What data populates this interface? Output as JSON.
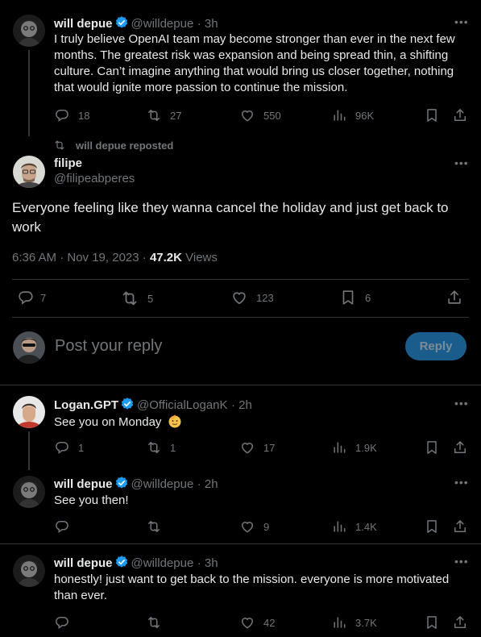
{
  "tweet1": {
    "name": "will depue",
    "handle": "@willdepue",
    "time": "· 3h",
    "text": "I truly believe OpenAI team may become stronger than ever in the next few months. The greatest risk was expansion and being spread thin, a shifting culture. Can’t imagine anything that would bring us closer together, nothing that would ignite more passion to continue the mission.",
    "replies": "18",
    "reposts": "27",
    "likes": "550",
    "views": "96K"
  },
  "repost_label": "will depue reposted",
  "main": {
    "name": "filipe",
    "handle": "@filipeabperes",
    "text": "Everyone feeling like they wanna cancel the holiday and just get back to work",
    "timestamp": "6:36 AM · Nov 19, 2023 · ",
    "views_count": "47.2K",
    "views_label": "Views",
    "replies": "7",
    "reposts": "5",
    "likes": "123",
    "bookmarks": "6"
  },
  "composer": {
    "placeholder": "Post your reply",
    "button": "Reply"
  },
  "reply1": {
    "name": "Logan.GPT",
    "handle": "@OfficialLoganK",
    "time": "· 2h",
    "text": "See you on Monday",
    "replies": "1",
    "reposts": "1",
    "likes": "17",
    "views": "1.9K"
  },
  "reply2": {
    "name": "will depue",
    "handle": "@willdepue",
    "time": "· 2h",
    "text": "See you then!",
    "likes": "9",
    "views": "1.4K"
  },
  "reply3": {
    "name": "will depue",
    "handle": "@willdepue",
    "time": "· 3h",
    "text": "honestly! just want to get back to the mission. everyone is more motivated than ever.",
    "likes": "42",
    "views": "3.7K"
  },
  "colors": {
    "background": "#000000",
    "text": "#e7e9ea",
    "muted": "#71767b",
    "verified": "#1d9bf0",
    "divider": "#2f3336",
    "reply_button": "#1a5d8d"
  }
}
